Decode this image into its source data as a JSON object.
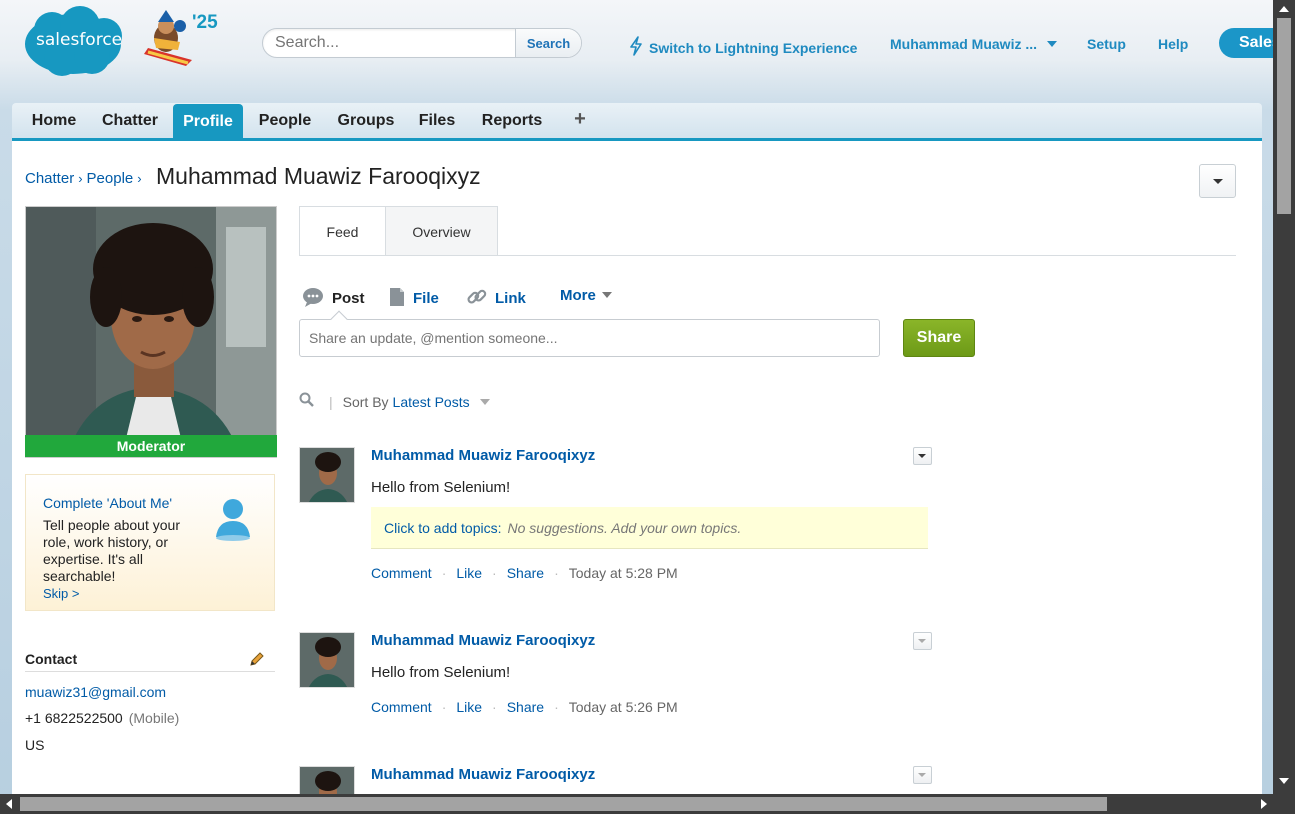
{
  "header": {
    "logo_text": "salesforce",
    "release_badge": "'25",
    "search_placeholder": "Search...",
    "search_button": "Search",
    "lightning_link": "Switch to Lightning Experience",
    "user_menu": "Muhammad Muawiz ...",
    "setup": "Setup",
    "help": "Help",
    "app_menu": "Sales"
  },
  "tabs": [
    {
      "label": "Home"
    },
    {
      "label": "Chatter"
    },
    {
      "label": "Profile",
      "active": true
    },
    {
      "label": "People"
    },
    {
      "label": "Groups"
    },
    {
      "label": "Files"
    },
    {
      "label": "Reports"
    },
    {
      "label": "+"
    }
  ],
  "breadcrumb": {
    "items": [
      "Chatter",
      "People"
    ]
  },
  "page_title": "Muhammad Muawiz Farooqixyz",
  "profile": {
    "badge": "Moderator",
    "about": {
      "title": "Complete 'About Me'",
      "text": "Tell people about your role, work history, or expertise. It's all searchable!",
      "skip": "Skip >"
    },
    "contact": {
      "title": "Contact",
      "email": "muawiz31@gmail.com",
      "phone": "+1 6822522500",
      "phone_type": "(Mobile)",
      "country": "US"
    }
  },
  "feed_tabs": [
    "Feed",
    "Overview"
  ],
  "publisher": {
    "actions": [
      "Post",
      "File",
      "Link",
      "More"
    ],
    "placeholder": "Share an update, @mention someone...",
    "share_button": "Share"
  },
  "sort": {
    "label": "Sort By",
    "value": "Latest Posts"
  },
  "posts": [
    {
      "author": "Muhammad Muawiz Farooqixyz",
      "body": "Hello from Selenium!",
      "topics_link": "Click to add topics:",
      "topics_note": "No suggestions. Add your own topics.",
      "actions": [
        "Comment",
        "Like",
        "Share"
      ],
      "time": "Today at 5:28 PM"
    },
    {
      "author": "Muhammad Muawiz Farooqixyz",
      "body": "Hello from Selenium!",
      "actions": [
        "Comment",
        "Like",
        "Share"
      ],
      "time": "Today at 5:26 PM"
    },
    {
      "author": "Muhammad Muawiz Farooqixyz"
    }
  ],
  "colors": {
    "brand_blue": "#1798c1",
    "link_blue": "#015ba7",
    "share_green": "#7aa61e",
    "moderator_green": "#21a83c"
  }
}
